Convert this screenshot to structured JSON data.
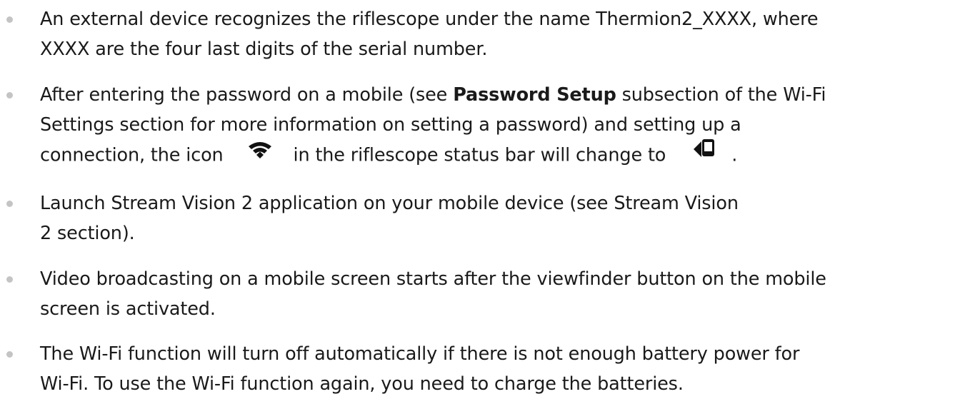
{
  "icons": {
    "wifi": "wifi-icon",
    "phone_connected": "phone-connected-icon"
  },
  "bullets": [
    {
      "line1": "An external device recognizes the riflescope under the name Thermion2_XXXX, where",
      "line2": "XXXX are the four last digits of the serial number."
    },
    {
      "line1_a": "After entering the password on a mobile (see ",
      "line1_bold": "Password Setup",
      "line1_b": " subsection of the ",
      "line1_link": "Wi-Fi",
      "line2_link": "Settings",
      "line2_b": " section for more information on setting a password) and setting up a",
      "line3_a": "connection, the icon",
      "line3_b": "in the riflescope status bar will change to",
      "line3_c": "."
    },
    {
      "line1_a": "Launch Stream Vision 2 application on your mobile device (see ",
      "line1_link": "Stream Vision",
      "line2_link": "2",
      "line2_b": " section)."
    },
    {
      "line1": "Video broadcasting on a mobile screen starts after the viewfinder button on the mobile",
      "line2": "screen is activated."
    },
    {
      "line1": "The Wi-Fi function will turn off automatically if there is not enough battery power for",
      "line2": "Wi-Fi. To use the Wi-Fi function again, you need to charge the batteries."
    }
  ]
}
